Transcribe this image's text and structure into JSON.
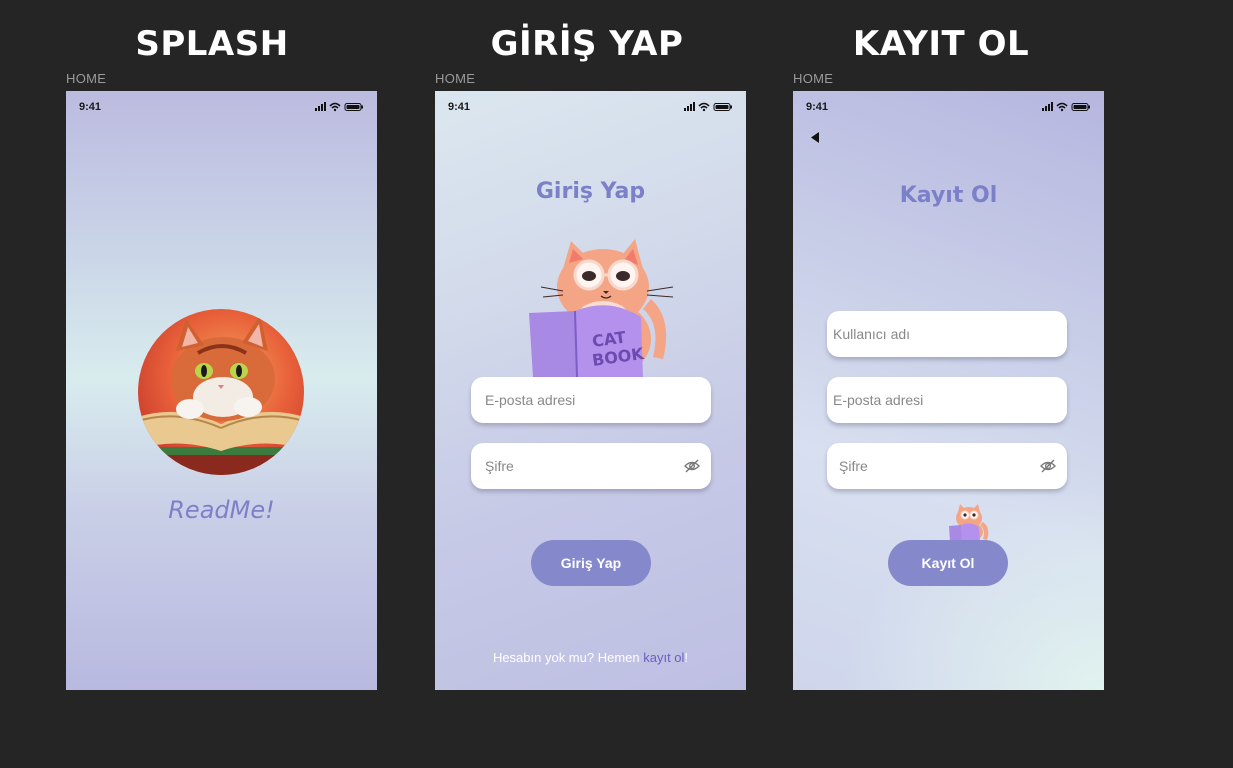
{
  "sections": [
    {
      "title": "SPLASH",
      "frame_label": "HOME"
    },
    {
      "title": "GİRİŞ YAP",
      "frame_label": "HOME"
    },
    {
      "title": "KAYIT OL",
      "frame_label": "HOME"
    }
  ],
  "status_bar": {
    "time": "9:41"
  },
  "splash": {
    "app_name": "ReadMe!"
  },
  "login": {
    "title": "Giriş Yap",
    "email_placeholder": "E-posta adresi",
    "password_placeholder": "Şifre",
    "submit_label": "Giriş Yap",
    "footer_text": "Hesabın yok mu? Hemen ",
    "footer_link": "kayıt ol",
    "footer_end": "!",
    "book_text_1": "CAT",
    "book_text_2": "BOOK"
  },
  "register": {
    "title": "Kayıt Ol",
    "username_placeholder": "Kullanıcı adı",
    "email_placeholder": "E-posta adresi",
    "password_placeholder": "Şifre",
    "submit_label": "Kayıt Ol"
  },
  "colors": {
    "background": "#252525",
    "accent": "#8688cc",
    "title": "#7c80c9",
    "link": "#6b60c2"
  }
}
